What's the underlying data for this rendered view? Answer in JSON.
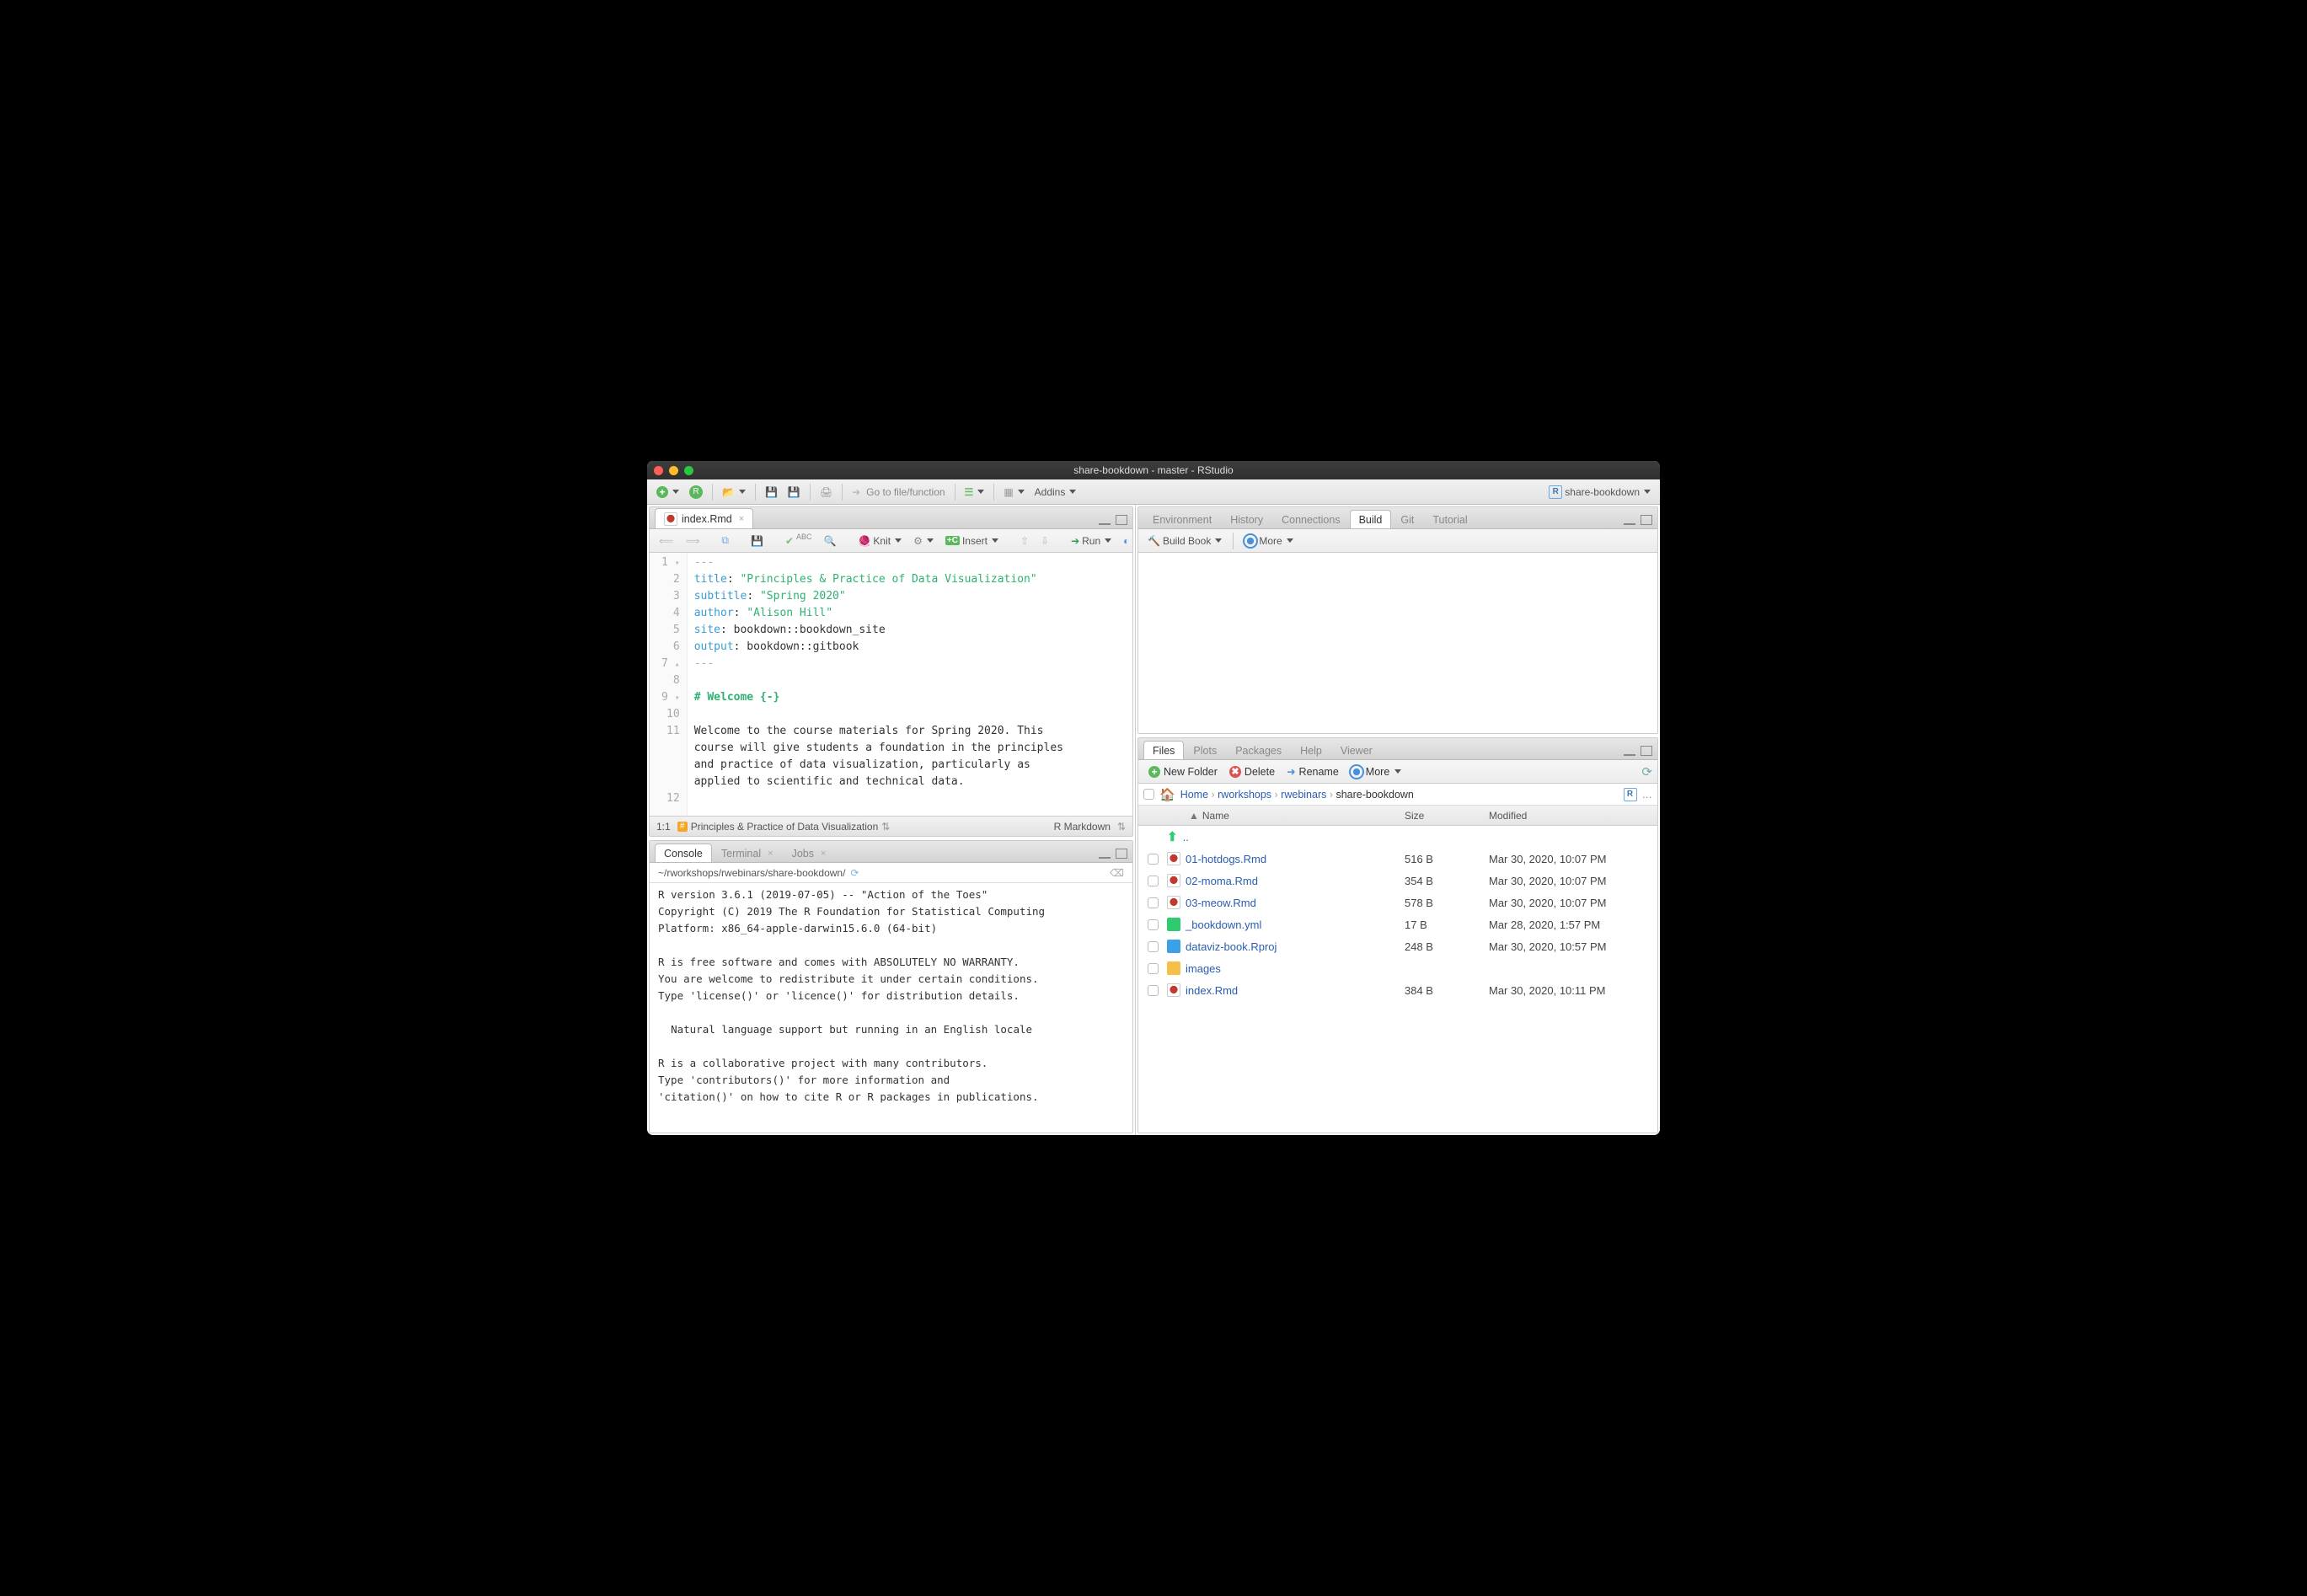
{
  "title": "share-bookdown - master - RStudio",
  "maintoolbar": {
    "goto_placeholder": "Go to file/function",
    "addins": "Addins",
    "project": "share-bookdown"
  },
  "source": {
    "tab": "index.Rmd",
    "knit": "Knit",
    "insert": "Insert",
    "run": "Run",
    "cursor": "1:1",
    "crumb": "Principles & Practice of Data Visualization",
    "lang": "R Markdown",
    "lines": [
      {
        "n": "1",
        "gut": "▾",
        "html": "<span class='d'>---</span>"
      },
      {
        "n": "2",
        "gut": "",
        "html": "<span class='k'>title</span>: <span class='s'>\"Principles &amp; Practice of Data Visualization\"</span>"
      },
      {
        "n": "3",
        "gut": "",
        "html": "<span class='k'>subtitle</span>: <span class='s'>\"Spring 2020\"</span>"
      },
      {
        "n": "4",
        "gut": "",
        "html": "<span class='k'>author</span>: <span class='s'>\"Alison Hill\"</span>"
      },
      {
        "n": "5",
        "gut": "",
        "html": "<span class='k'>site</span>: bookdown::bookdown_site"
      },
      {
        "n": "6",
        "gut": "",
        "html": "<span class='k'>output</span>: bookdown::gitbook"
      },
      {
        "n": "7",
        "gut": "▴",
        "html": "<span class='d'>---</span>"
      },
      {
        "n": "8",
        "gut": "",
        "html": ""
      },
      {
        "n": "9",
        "gut": "▾",
        "html": "<span class='h'># Welcome {-}</span>"
      },
      {
        "n": "10",
        "gut": "",
        "html": ""
      },
      {
        "n": "11",
        "gut": "",
        "html": "Welcome to the course materials for Spring 2020. This\ncourse will give students a foundation in the principles\nand practice of data visualization, particularly as\napplied to scientific and technical data."
      },
      {
        "n": "12",
        "gut": "",
        "html": ""
      }
    ]
  },
  "console": {
    "tabs": [
      "Console",
      "Terminal",
      "Jobs"
    ],
    "path": "~/rworkshops/rwebinars/share-bookdown/",
    "text": "R version 3.6.1 (2019-07-05) -- \"Action of the Toes\"\nCopyright (C) 2019 The R Foundation for Statistical Computing\nPlatform: x86_64-apple-darwin15.6.0 (64-bit)\n\nR is free software and comes with ABSOLUTELY NO WARRANTY.\nYou are welcome to redistribute it under certain conditions.\nType 'license()' or 'licence()' for distribution details.\n\n  Natural language support but running in an English locale\n\nR is a collaborative project with many contributors.\nType 'contributors()' for more information and\n'citation()' on how to cite R or R packages in publications."
  },
  "upperRight": {
    "tabs": [
      "Environment",
      "History",
      "Connections",
      "Build",
      "Git",
      "Tutorial"
    ],
    "active": "Build",
    "buildbook": "Build Book",
    "more": "More"
  },
  "files": {
    "tabs": [
      "Files",
      "Plots",
      "Packages",
      "Help",
      "Viewer"
    ],
    "active": "Files",
    "actions": {
      "newfolder": "New Folder",
      "delete": "Delete",
      "rename": "Rename",
      "more": "More"
    },
    "breadcrumb": [
      "Home",
      "rworkshops",
      "rwebinars",
      "share-bookdown"
    ],
    "head": {
      "name": "Name",
      "size": "Size",
      "modified": "Modified"
    },
    "up": "..",
    "rows": [
      {
        "icon": "rmd",
        "name": "01-hotdogs.Rmd",
        "size": "516 B",
        "mod": "Mar 30, 2020, 10:07 PM"
      },
      {
        "icon": "rmd",
        "name": "02-moma.Rmd",
        "size": "354 B",
        "mod": "Mar 30, 2020, 10:07 PM"
      },
      {
        "icon": "rmd",
        "name": "03-meow.Rmd",
        "size": "578 B",
        "mod": "Mar 30, 2020, 10:07 PM"
      },
      {
        "icon": "yml",
        "name": "_bookdown.yml",
        "size": "17 B",
        "mod": "Mar 28, 2020, 1:57 PM"
      },
      {
        "icon": "rproj",
        "name": "dataviz-book.Rproj",
        "size": "248 B",
        "mod": "Mar 30, 2020, 10:57 PM"
      },
      {
        "icon": "folder",
        "name": "images",
        "size": "",
        "mod": ""
      },
      {
        "icon": "rmd",
        "name": "index.Rmd",
        "size": "384 B",
        "mod": "Mar 30, 2020, 10:11 PM"
      }
    ]
  }
}
